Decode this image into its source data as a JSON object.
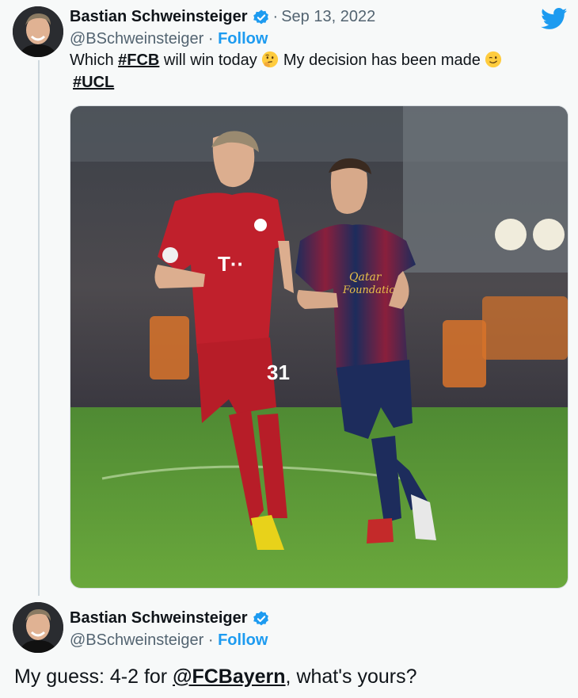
{
  "tweet": {
    "author_name": "Bastian Schweinsteiger",
    "date_separator": "·",
    "date": "Sep 13, 2022",
    "handle": "@BSchweinsteiger",
    "follow_separator": "·",
    "follow_label": "Follow",
    "text_part1": "Which ",
    "hashtag1": "#FCB",
    "text_part2": " will win today ",
    "text_part3": " My decision has been made ",
    "hashtag2": "#UCL",
    "media": {
      "jersey_text_left": "T··",
      "number_left": "31",
      "jersey_text_right_line1": "Qatar",
      "jersey_text_right_line2": "Foundation"
    }
  },
  "reply": {
    "author_name": "Bastian Schweinsteiger",
    "handle": "@BSchweinsteiger",
    "follow_separator": "·",
    "follow_label": "Follow",
    "text_prefix": "My guess: 4-2 for ",
    "mention": "@FCBayern",
    "text_suffix": ", what's yours?"
  },
  "colors": {
    "accent": "#1d9bf0",
    "background": "#f7f9f9",
    "secondary_text": "#536471"
  },
  "icons": [
    "verified-badge-icon",
    "twitter-bird-icon",
    "thinking-face-emoji-icon",
    "winking-face-emoji-icon"
  ]
}
